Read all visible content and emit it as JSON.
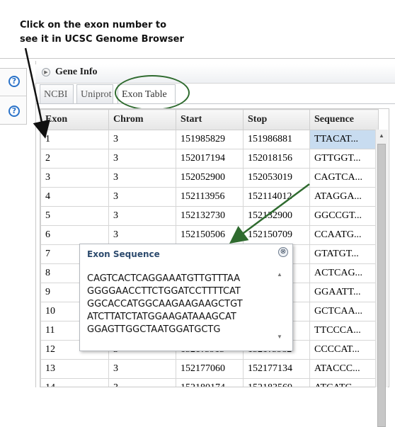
{
  "annotation": {
    "line1": "Click on the exon number to",
    "line2": "see it in UCSC Genome Browser"
  },
  "sidebar": {
    "help_icon_glyph": "?"
  },
  "panel": {
    "title": "Gene Info",
    "toggle_glyph": "▶"
  },
  "tabs": [
    {
      "label": "NCBI",
      "active": false
    },
    {
      "label": "Uniprot",
      "active": false
    },
    {
      "label": "Exon Table",
      "active": true
    }
  ],
  "table": {
    "columns": [
      "Exon",
      "Chrom",
      "Start",
      "Stop",
      "Sequence"
    ],
    "rows": [
      [
        "1",
        "3",
        "151985829",
        "151986881",
        "TTACAT..."
      ],
      [
        "2",
        "3",
        "152017194",
        "152018156",
        "GTTGGT..."
      ],
      [
        "3",
        "3",
        "152052900",
        "152053019",
        "CAGTCA..."
      ],
      [
        "4",
        "3",
        "152113956",
        "152114012",
        "ATAGGA..."
      ],
      [
        "5",
        "3",
        "152132730",
        "152132900",
        "GGCCGT..."
      ],
      [
        "6",
        "3",
        "152150506",
        "152150709",
        "CCAATG..."
      ],
      [
        "7",
        "3",
        "",
        "...3",
        "GTATGT..."
      ],
      [
        "8",
        "3",
        "",
        "...5",
        "ACTCAG..."
      ],
      [
        "9",
        "3",
        "",
        "...2",
        "GGAATT..."
      ],
      [
        "10",
        "3",
        "",
        "...5",
        "GCTCAA..."
      ],
      [
        "11",
        "3",
        "",
        "...0",
        "TTCCCA..."
      ],
      [
        "12",
        "3",
        "1521?5915",
        "1521?5982",
        "CCCCAT..."
      ],
      [
        "13",
        "3",
        "152177060",
        "152177134",
        "ATACCC..."
      ],
      [
        "14",
        "3",
        "152180174",
        "152183569",
        "ATCATG..."
      ]
    ]
  },
  "popup": {
    "title": "Exon Sequence",
    "close_glyph": "⊗",
    "sequence_lines": [
      "CAGTCACTCAGGAAATGTTGTTTAA",
      "GGGGAACCTTCTGGATCCTTTTCAT",
      "GGCACCATGGCAAGAAGAAGCTGT",
      "ATCTTATCTATGGAAGATAAAGCAT",
      "GGAGTTGGCTAATGGATGCTG"
    ]
  },
  "colors": {
    "oval": "#2f6b2f",
    "arrow_black": "#111111",
    "arrow_green": "#2f6b2f",
    "selected_cell": "#c8dcf0",
    "popup_title": "#2d4b6e"
  }
}
